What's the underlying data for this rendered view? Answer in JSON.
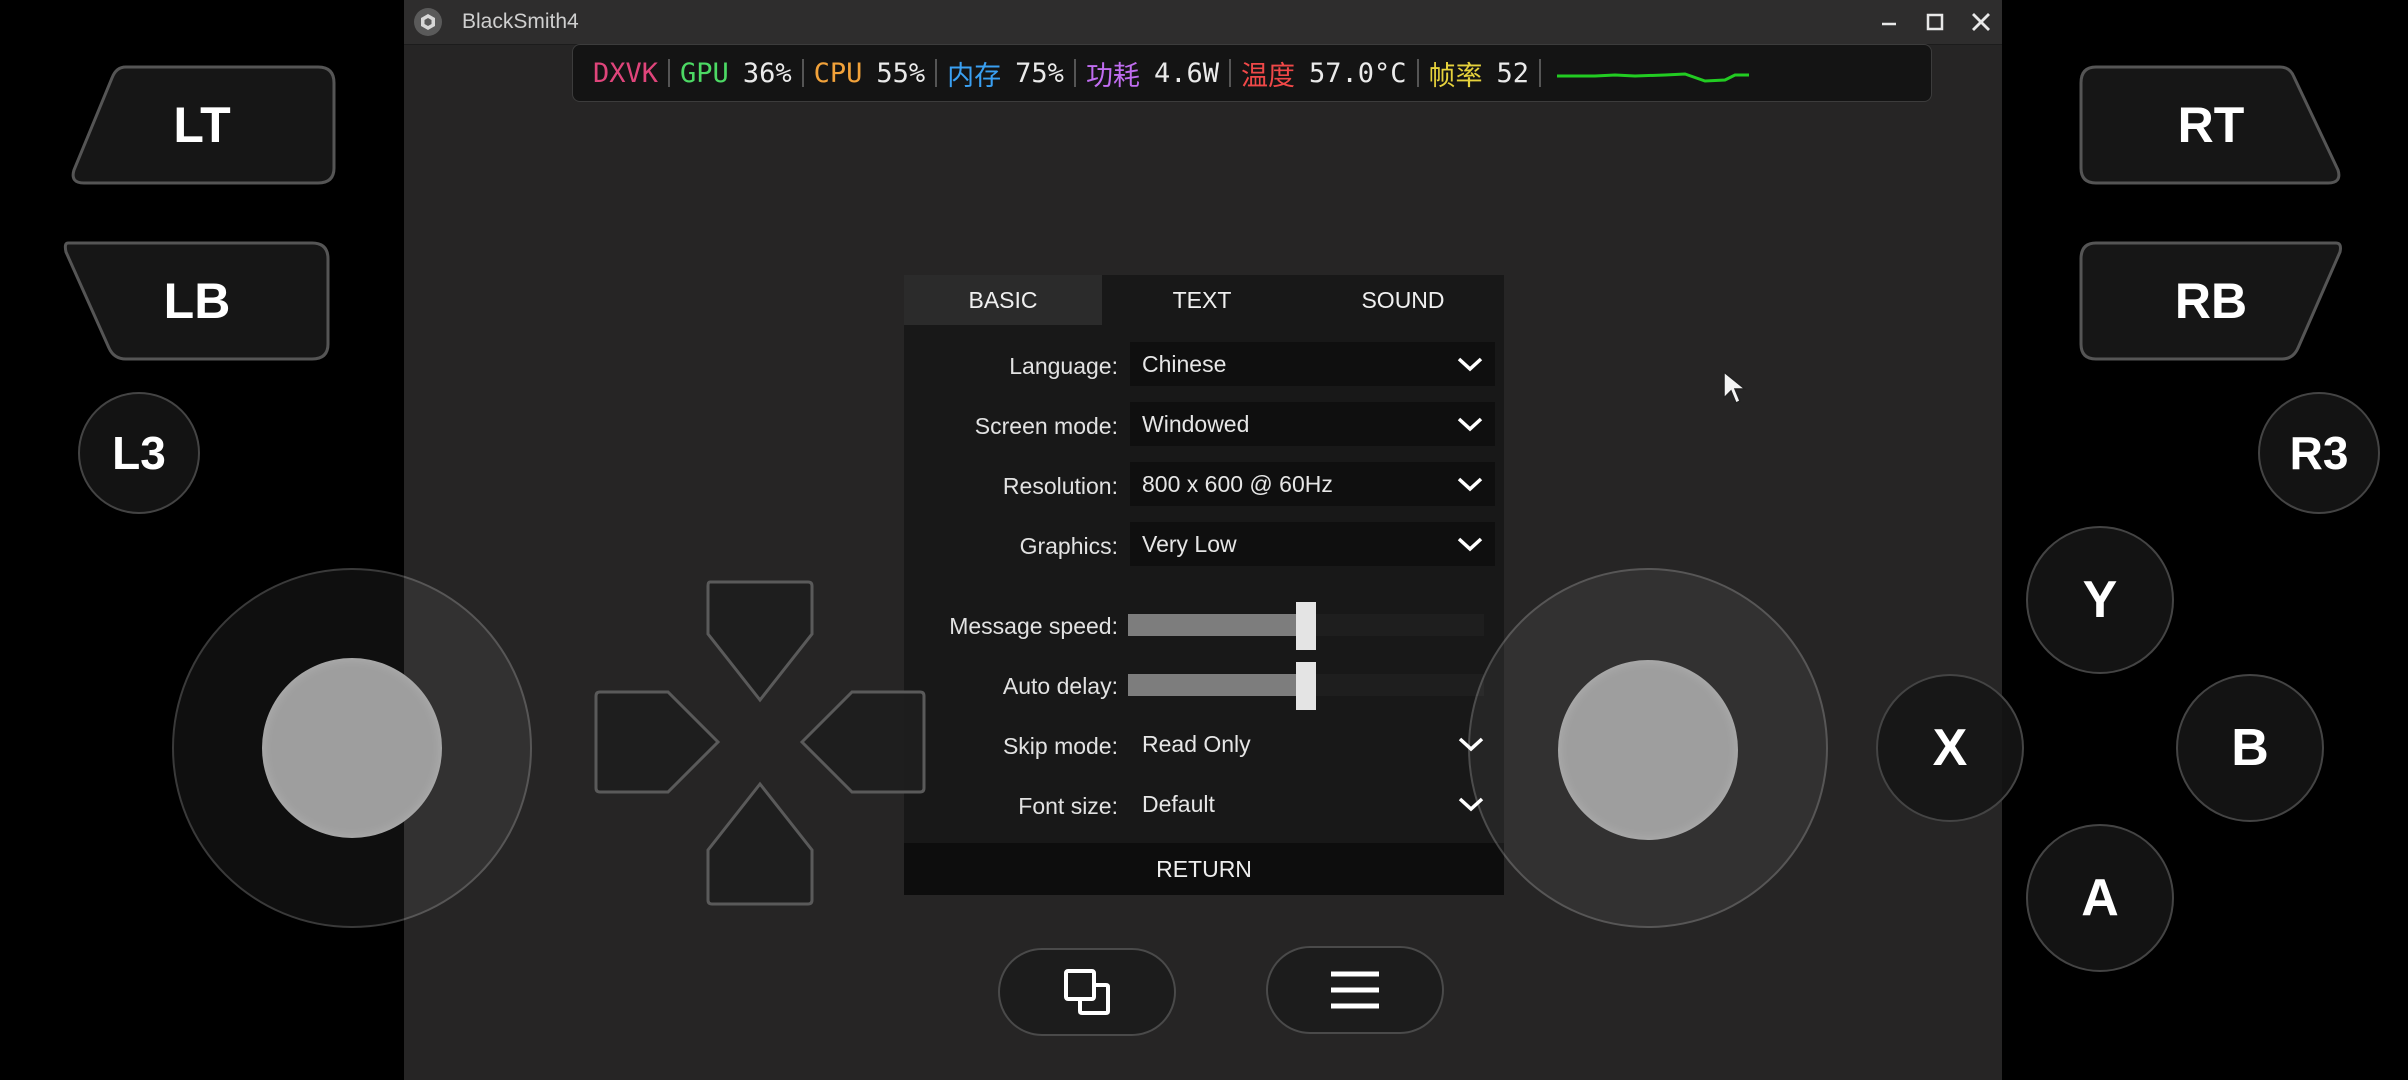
{
  "window": {
    "title": "BlackSmith4",
    "minimize_icon": "minimize-icon",
    "maximize_icon": "maximize-icon",
    "close_icon": "close-icon"
  },
  "hud": {
    "dxvk": "DXVK",
    "gpu_label": "GPU",
    "gpu_value": "36%",
    "cpu_label": "CPU",
    "cpu_value": "55%",
    "mem_label": "内存",
    "mem_value": "75%",
    "power_label": "功耗",
    "power_value": "4.6W",
    "temp_label": "温度",
    "temp_value": "57.0°C",
    "fps_label": "帧率",
    "fps_value": "52",
    "colors": {
      "dxvk": "#e0457b",
      "gpu": "#4cd964",
      "cpu": "#f2a23a",
      "mem": "#3aa0f2",
      "power": "#c06df0",
      "temp": "#f04848",
      "fps": "#e6d23c",
      "graph": "#22cc22"
    }
  },
  "settings": {
    "tabs": [
      {
        "label": "BASIC",
        "active": true
      },
      {
        "label": "TEXT",
        "active": false
      },
      {
        "label": "SOUND",
        "active": false
      }
    ],
    "language": {
      "label": "Language:",
      "value": "Chinese"
    },
    "screen_mode": {
      "label": "Screen mode:",
      "value": "Windowed"
    },
    "resolution": {
      "label": "Resolution:",
      "value": "800 x 600 @ 60Hz"
    },
    "graphics": {
      "label": "Graphics:",
      "value": "Very Low"
    },
    "message_speed": {
      "label": "Message speed:",
      "level": 0.5
    },
    "auto_delay": {
      "label": "Auto delay:",
      "level": 0.5
    },
    "skip_mode": {
      "label": "Skip mode:",
      "value": "Read Only"
    },
    "font_size": {
      "label": "Font size:",
      "value": "Default"
    },
    "return_label": "RETURN"
  },
  "gamepad": {
    "lt": "LT",
    "lb": "LB",
    "l3": "L3",
    "rt": "RT",
    "rb": "RB",
    "r3": "R3",
    "y": "Y",
    "x": "X",
    "b": "B",
    "a": "A",
    "windows_icon": "windows-icon",
    "menu_icon": "menu-icon"
  }
}
